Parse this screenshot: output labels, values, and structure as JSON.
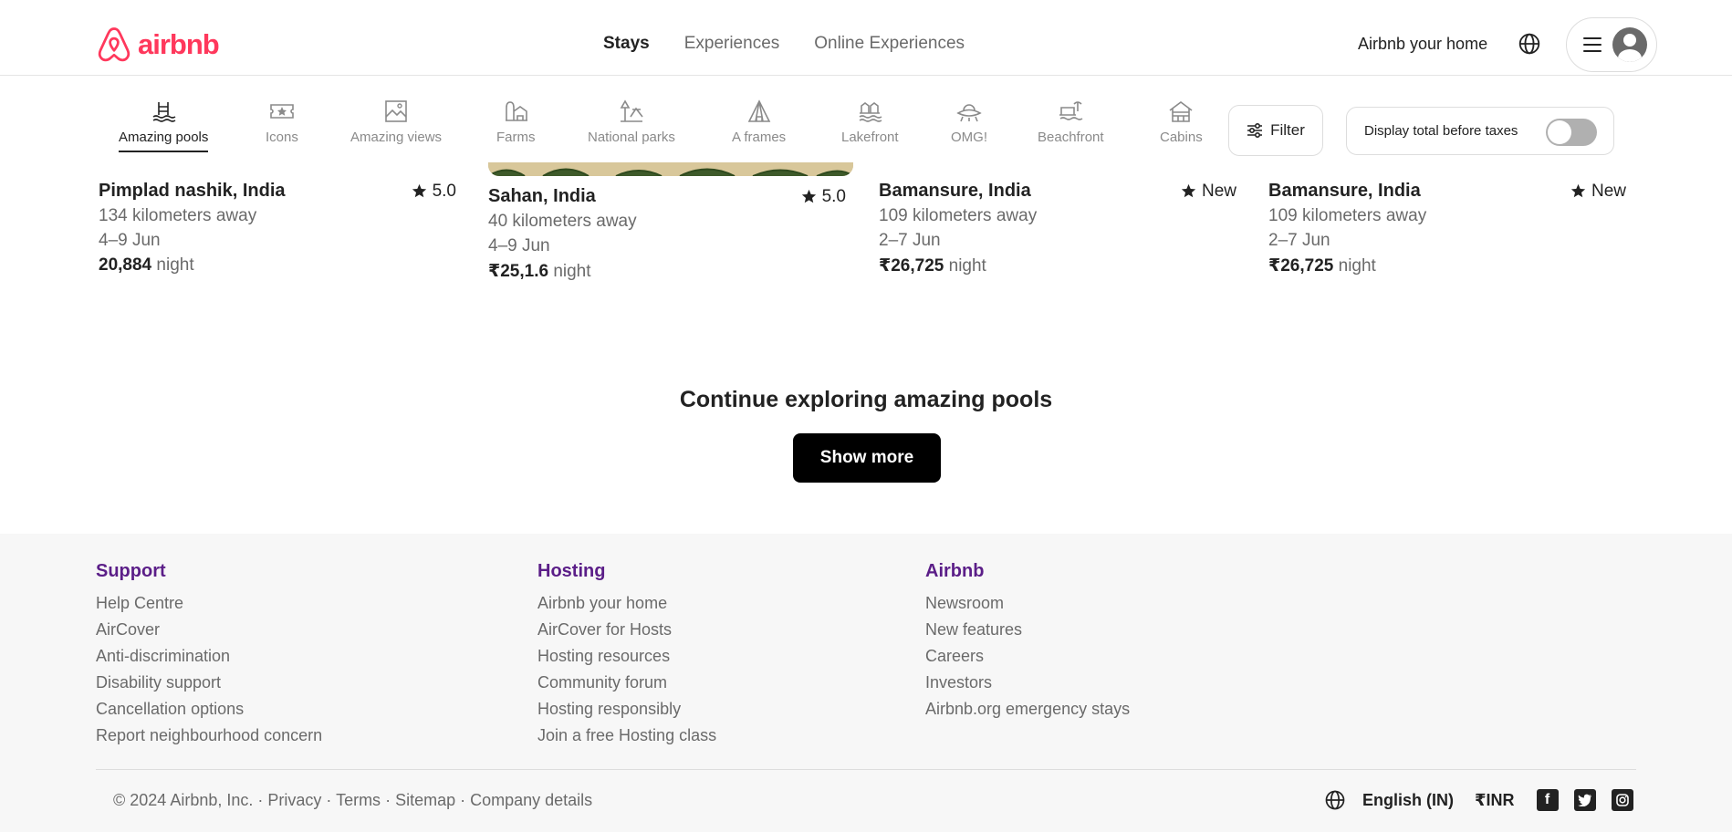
{
  "header": {
    "brand": "airbnb",
    "nav": [
      "Stays",
      "Experiences",
      "Online Experiences"
    ],
    "active_nav": "Stays",
    "host_link": "Airbnb your home",
    "icons": [
      "airbnb-logo-icon",
      "globe-icon",
      "menu-icon",
      "user-avatar-icon"
    ]
  },
  "categories": {
    "items": [
      {
        "label": "Amazing pools",
        "icon": "pool-icon",
        "active": true
      },
      {
        "label": "Icons",
        "icon": "ticket-icon",
        "active": false
      },
      {
        "label": "Amazing views",
        "icon": "views-icon",
        "active": false
      },
      {
        "label": "Farms",
        "icon": "farm-icon",
        "active": false
      },
      {
        "label": "National parks",
        "icon": "park-icon",
        "active": false
      },
      {
        "label": "A frames",
        "icon": "aframe-icon",
        "active": false
      },
      {
        "label": "Lakefront",
        "icon": "lake-icon",
        "active": false
      },
      {
        "label": "OMG!",
        "icon": "ufo-icon",
        "active": false
      },
      {
        "label": "Beachfront",
        "icon": "beach-icon",
        "active": false
      },
      {
        "label": "Cabins",
        "icon": "cabin-icon",
        "active": false
      }
    ],
    "filter_label": "Filter",
    "taxes_label": "Display total before taxes",
    "taxes_toggle_on": false
  },
  "listings": [
    {
      "location": "Pimplad nashik, India",
      "rating": "5.0",
      "distance": "134 kilometers away",
      "dates": "4–9 Jun",
      "price": "20,884",
      "price_suffix": " night"
    },
    {
      "location": "Sahan, India",
      "rating": "5.0",
      "distance": "40 kilometers away",
      "dates": "4–9 Jun",
      "price": "₹25,1.6",
      "price_suffix": " night"
    },
    {
      "location": "Bamansure, India",
      "rating": "New",
      "distance": "109 kilometers away",
      "dates": "2–7 Jun",
      "price": "₹26,725",
      "price_suffix": " night"
    },
    {
      "location": "Bamansure, India",
      "rating": "New",
      "distance": "109 kilometers away",
      "dates": "2–7 Jun",
      "price": "₹26,725",
      "price_suffix": " night"
    }
  ],
  "continue": {
    "title": "Continue exploring amazing pools",
    "button": "Show more"
  },
  "footer": {
    "columns": [
      {
        "heading": "Support",
        "links": [
          "Help Centre",
          "AirCover",
          "Anti-discrimination",
          "Disability support",
          "Cancellation options",
          "Report neighbourhood concern"
        ]
      },
      {
        "heading": "Hosting",
        "links": [
          "Airbnb your home",
          "AirCover for Hosts",
          "Hosting resources",
          "Community forum",
          "Hosting responsibly",
          "Join a free Hosting class"
        ]
      },
      {
        "heading": "Airbnb",
        "links": [
          "Newsroom",
          "New features",
          "Careers",
          "Investors",
          "Airbnb.org emergency stays"
        ]
      }
    ],
    "copyright": "© 2024 Airbnb, Inc.",
    "legal_links": [
      "Privacy",
      "Terms",
      "Sitemap",
      "Company details"
    ],
    "separator": " · ",
    "language": "English (IN)",
    "currency": "₹INR",
    "social_icons": [
      "facebook-icon",
      "twitter-icon",
      "instagram-icon"
    ]
  },
  "colors": {
    "brand": "#ff385c",
    "footer_heading": "#5b1e88",
    "footer_bg": "#f7f7f7",
    "muted_text": "#6a6a6a"
  }
}
